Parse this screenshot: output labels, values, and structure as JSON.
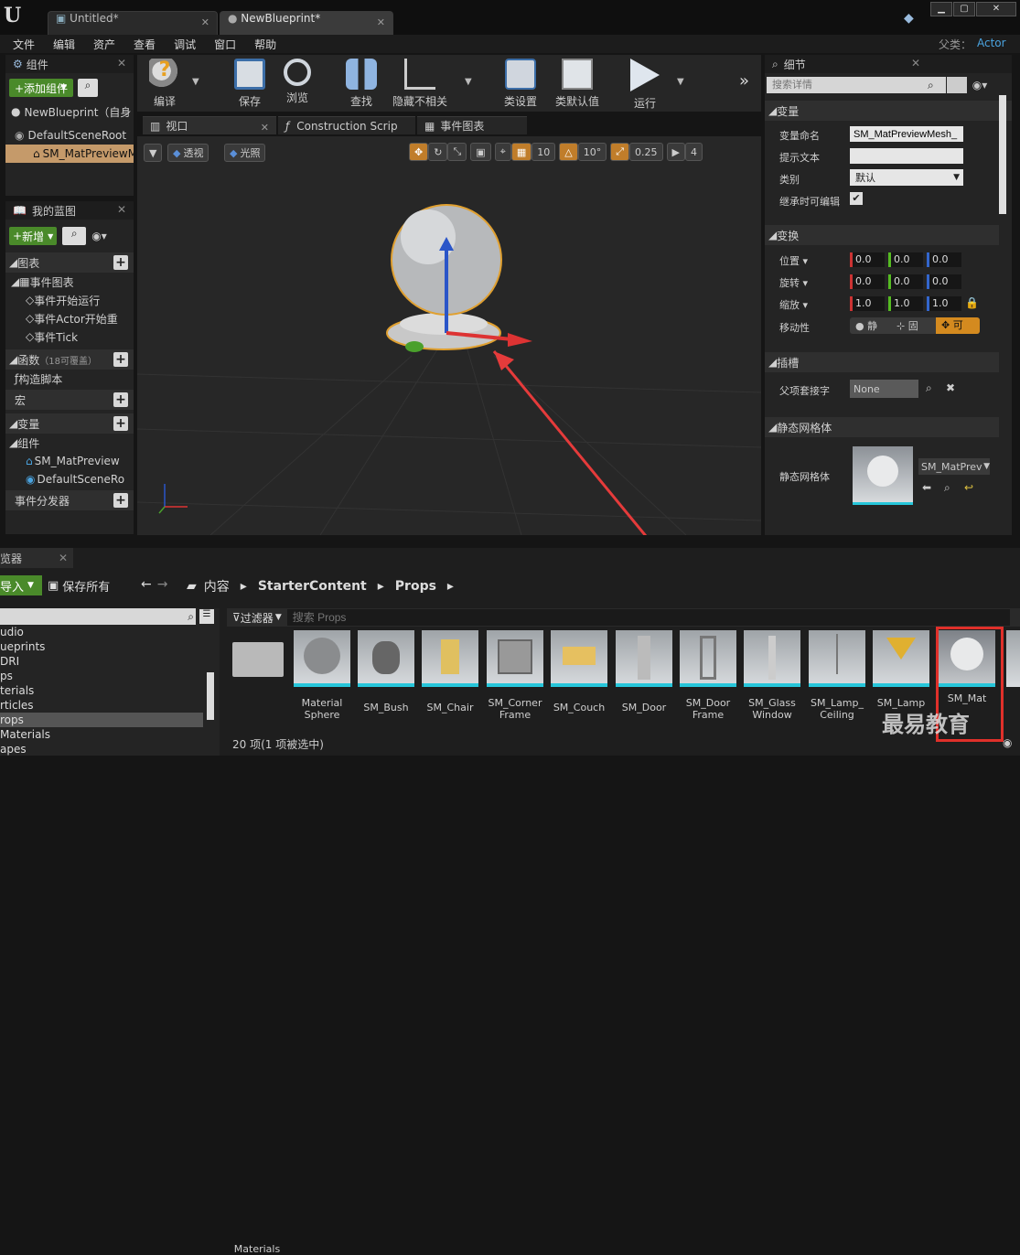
{
  "titlebar": {
    "tabs": [
      {
        "label": "Untitled*"
      },
      {
        "label": "NewBlueprint*"
      }
    ]
  },
  "menubar": {
    "items": [
      "文件",
      "编辑",
      "资产",
      "查看",
      "调试",
      "窗口",
      "帮助"
    ],
    "parent_label": "父类：",
    "parent_value": "Actor"
  },
  "components": {
    "title": "组件",
    "add_button": "+添加组件",
    "items": [
      "NewBlueprint（自身",
      "DefaultSceneRoot",
      "SM_MatPreviewM"
    ]
  },
  "toolbar": {
    "items": [
      "编译",
      "保存",
      "浏览",
      "查找",
      "隐藏不相关",
      "类设置",
      "类默认值",
      "运行"
    ]
  },
  "my_blueprint": {
    "title": "我的蓝图",
    "add_button": "新增",
    "graphs_label": "图表",
    "event_graph": "事件图表",
    "events": [
      "事件开始运行",
      "事件Actor开始重",
      "事件Tick"
    ],
    "functions_label": "函数",
    "functions_note": "（18可覆盖）",
    "construction_script": "构造脚本",
    "macros_label": "宏",
    "variables_label": "变量",
    "components_label": "组件",
    "component_vars": [
      "SM_MatPreview",
      "DefaultSceneRo"
    ],
    "dispatchers_label": "事件分发器"
  },
  "viewport": {
    "tabs": [
      "视口",
      "Construction Scrip",
      "事件图表"
    ],
    "perspective": "透视",
    "lit": "光照",
    "grid_snap": "10",
    "rot_snap": "10°",
    "scale_snap": "0.25",
    "cam_speed": "4"
  },
  "details": {
    "title": "细节",
    "search_placeholder": "搜索详情",
    "variable_section": "变量",
    "var_name_label": "变量命名",
    "var_name_value": "SM_MatPreviewMesh_",
    "tooltip_label": "提示文本",
    "category_label": "类别",
    "category_value": "默认",
    "editable_label": "继承时可编辑",
    "transform_section": "变换",
    "location_label": "位置",
    "rotation_label": "旋转",
    "scale_label": "缩放",
    "location": [
      "0.0",
      "0.0",
      "0.0"
    ],
    "rotation": [
      "0.0",
      "0.0",
      "0.0"
    ],
    "scale": [
      "1.0",
      "1.0",
      "1.0"
    ],
    "mobility_label": "移动性",
    "mobility_options": [
      "静",
      "固",
      "可"
    ],
    "socket_section": "插槽",
    "parent_socket_label": "父项套接字",
    "parent_socket_value": "None",
    "mesh_section": "静态网格体",
    "mesh_label": "静态网格体",
    "mesh_value": "SM_MatPrev"
  },
  "content_browser": {
    "tab": "览器",
    "import_button": "导入",
    "save_all": "保存所有",
    "breadcrumb": [
      "内容",
      "StarterContent",
      "Props"
    ],
    "tree_items": [
      "udio",
      "ueprints",
      "DRI",
      "ps",
      "terials",
      "rticles",
      "rops",
      "Materials",
      "apes"
    ],
    "filter_label": "过滤器",
    "search_placeholder": "搜索 Props",
    "assets": [
      "Materials",
      "Material Sphere",
      "SM_Bush",
      "SM_Chair",
      "SM_Corner Frame",
      "SM_Couch",
      "SM_Door",
      "SM_Door Frame",
      "SM_Glass Window",
      "SM_Lamp_ Ceiling",
      "SM_Lamp",
      "SM_Mat"
    ],
    "status": "20 项(1 项被选中)"
  },
  "watermark": "最易教育"
}
